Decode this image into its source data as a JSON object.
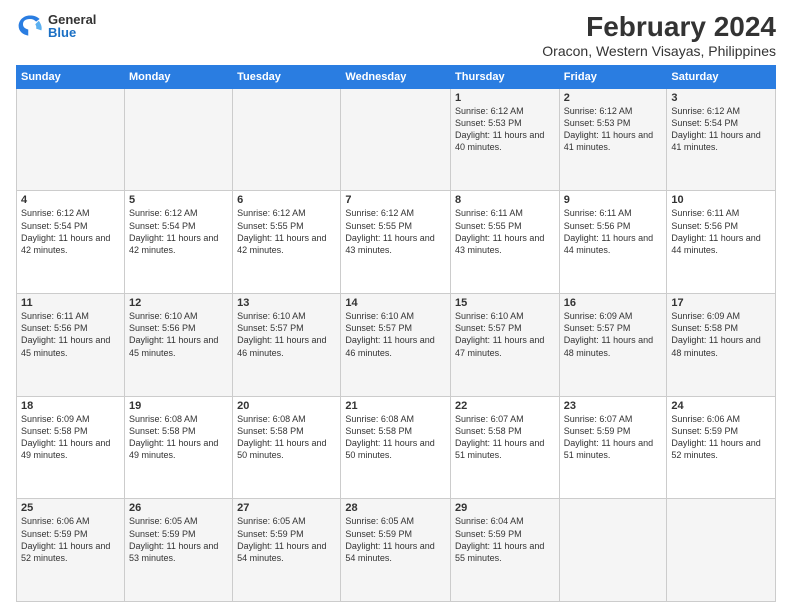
{
  "logo": {
    "general": "General",
    "blue": "Blue"
  },
  "title": "February 2024",
  "subtitle": "Oracon, Western Visayas, Philippines",
  "days_of_week": [
    "Sunday",
    "Monday",
    "Tuesday",
    "Wednesday",
    "Thursday",
    "Friday",
    "Saturday"
  ],
  "weeks": [
    [
      {
        "day": "",
        "info": ""
      },
      {
        "day": "",
        "info": ""
      },
      {
        "day": "",
        "info": ""
      },
      {
        "day": "",
        "info": ""
      },
      {
        "day": "1",
        "info": "Sunrise: 6:12 AM\nSunset: 5:53 PM\nDaylight: 11 hours and 40 minutes."
      },
      {
        "day": "2",
        "info": "Sunrise: 6:12 AM\nSunset: 5:53 PM\nDaylight: 11 hours and 41 minutes."
      },
      {
        "day": "3",
        "info": "Sunrise: 6:12 AM\nSunset: 5:54 PM\nDaylight: 11 hours and 41 minutes."
      }
    ],
    [
      {
        "day": "4",
        "info": "Sunrise: 6:12 AM\nSunset: 5:54 PM\nDaylight: 11 hours and 42 minutes."
      },
      {
        "day": "5",
        "info": "Sunrise: 6:12 AM\nSunset: 5:54 PM\nDaylight: 11 hours and 42 minutes."
      },
      {
        "day": "6",
        "info": "Sunrise: 6:12 AM\nSunset: 5:55 PM\nDaylight: 11 hours and 42 minutes."
      },
      {
        "day": "7",
        "info": "Sunrise: 6:12 AM\nSunset: 5:55 PM\nDaylight: 11 hours and 43 minutes."
      },
      {
        "day": "8",
        "info": "Sunrise: 6:11 AM\nSunset: 5:55 PM\nDaylight: 11 hours and 43 minutes."
      },
      {
        "day": "9",
        "info": "Sunrise: 6:11 AM\nSunset: 5:56 PM\nDaylight: 11 hours and 44 minutes."
      },
      {
        "day": "10",
        "info": "Sunrise: 6:11 AM\nSunset: 5:56 PM\nDaylight: 11 hours and 44 minutes."
      }
    ],
    [
      {
        "day": "11",
        "info": "Sunrise: 6:11 AM\nSunset: 5:56 PM\nDaylight: 11 hours and 45 minutes."
      },
      {
        "day": "12",
        "info": "Sunrise: 6:10 AM\nSunset: 5:56 PM\nDaylight: 11 hours and 45 minutes."
      },
      {
        "day": "13",
        "info": "Sunrise: 6:10 AM\nSunset: 5:57 PM\nDaylight: 11 hours and 46 minutes."
      },
      {
        "day": "14",
        "info": "Sunrise: 6:10 AM\nSunset: 5:57 PM\nDaylight: 11 hours and 46 minutes."
      },
      {
        "day": "15",
        "info": "Sunrise: 6:10 AM\nSunset: 5:57 PM\nDaylight: 11 hours and 47 minutes."
      },
      {
        "day": "16",
        "info": "Sunrise: 6:09 AM\nSunset: 5:57 PM\nDaylight: 11 hours and 48 minutes."
      },
      {
        "day": "17",
        "info": "Sunrise: 6:09 AM\nSunset: 5:58 PM\nDaylight: 11 hours and 48 minutes."
      }
    ],
    [
      {
        "day": "18",
        "info": "Sunrise: 6:09 AM\nSunset: 5:58 PM\nDaylight: 11 hours and 49 minutes."
      },
      {
        "day": "19",
        "info": "Sunrise: 6:08 AM\nSunset: 5:58 PM\nDaylight: 11 hours and 49 minutes."
      },
      {
        "day": "20",
        "info": "Sunrise: 6:08 AM\nSunset: 5:58 PM\nDaylight: 11 hours and 50 minutes."
      },
      {
        "day": "21",
        "info": "Sunrise: 6:08 AM\nSunset: 5:58 PM\nDaylight: 11 hours and 50 minutes."
      },
      {
        "day": "22",
        "info": "Sunrise: 6:07 AM\nSunset: 5:58 PM\nDaylight: 11 hours and 51 minutes."
      },
      {
        "day": "23",
        "info": "Sunrise: 6:07 AM\nSunset: 5:59 PM\nDaylight: 11 hours and 51 minutes."
      },
      {
        "day": "24",
        "info": "Sunrise: 6:06 AM\nSunset: 5:59 PM\nDaylight: 11 hours and 52 minutes."
      }
    ],
    [
      {
        "day": "25",
        "info": "Sunrise: 6:06 AM\nSunset: 5:59 PM\nDaylight: 11 hours and 52 minutes."
      },
      {
        "day": "26",
        "info": "Sunrise: 6:05 AM\nSunset: 5:59 PM\nDaylight: 11 hours and 53 minutes."
      },
      {
        "day": "27",
        "info": "Sunrise: 6:05 AM\nSunset: 5:59 PM\nDaylight: 11 hours and 54 minutes."
      },
      {
        "day": "28",
        "info": "Sunrise: 6:05 AM\nSunset: 5:59 PM\nDaylight: 11 hours and 54 minutes."
      },
      {
        "day": "29",
        "info": "Sunrise: 6:04 AM\nSunset: 5:59 PM\nDaylight: 11 hours and 55 minutes."
      },
      {
        "day": "",
        "info": ""
      },
      {
        "day": "",
        "info": ""
      }
    ]
  ]
}
